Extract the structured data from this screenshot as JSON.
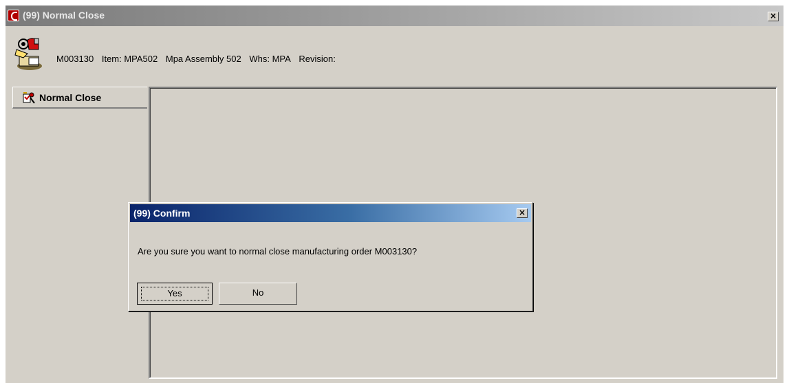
{
  "window": {
    "title": "(99) Normal Close",
    "close_label": "×"
  },
  "order": {
    "number": "M003130",
    "item": "Item: MPA502",
    "description": "Mpa Assembly 502",
    "warehouse": "Whs: MPA",
    "revision": "Revision:"
  },
  "tabs": [
    {
      "label": "Normal Close",
      "icon": "normal-close-icon"
    }
  ],
  "dialog": {
    "title": "(99) Confirm",
    "close_label": "×",
    "message": "Are you sure you want to normal close manufacturing order M003130?",
    "yes_label": "Yes",
    "no_label": "No"
  },
  "colors": {
    "window_bg": "#d4d0c8",
    "dialog_title_start": "#0a246a",
    "dialog_title_end": "#a6caf0",
    "app_icon": "#b00000"
  }
}
